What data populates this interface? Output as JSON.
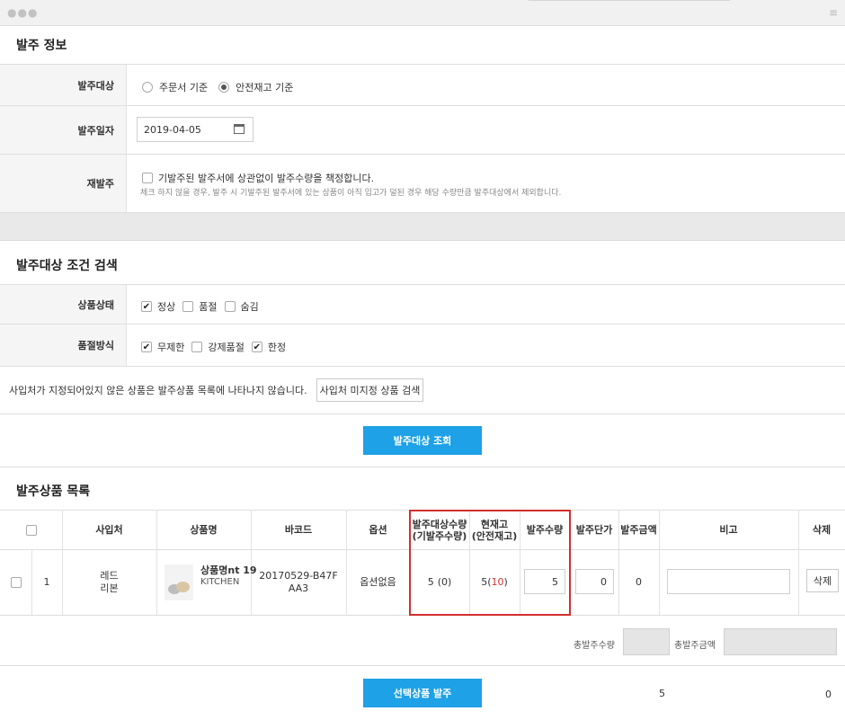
{
  "window": {
    "dots": "●●●",
    "menu_icon": "hamburger-icon"
  },
  "order_info": {
    "title": "발주 정보",
    "target": {
      "label": "발주대상",
      "options": [
        "주문서 기준",
        "안전재고 기준"
      ],
      "selected": "안전재고 기준"
    },
    "date": {
      "label": "발주일자",
      "value": "2019-04-05",
      "icon": "calendar-icon"
    },
    "reorder": {
      "label": "재발주",
      "checkbox_label": "기발주된 발주서에 상관없이 발주수량을 책정합니다.",
      "checked": false,
      "note": "체크 하지 않을 경우, 발주 시 기발주된 발주서에 있는 상품이 아직 입고가 덜된 경우 해당 수량만큼 발주대상에서 제외합니다."
    }
  },
  "search": {
    "title": "발주대상 조건 검색",
    "status": {
      "label": "상품상태",
      "options": [
        {
          "label": "정상",
          "checked": true
        },
        {
          "label": "품절",
          "checked": false
        },
        {
          "label": "숨김",
          "checked": false
        }
      ]
    },
    "soldout_method": {
      "label": "품절방식",
      "options": [
        {
          "label": "무제한",
          "checked": true
        },
        {
          "label": "강제품절",
          "checked": false
        },
        {
          "label": "한정",
          "checked": true
        }
      ]
    },
    "supplier_note": "사입처가 지정되어있지 않은 상품은 발주상품 목록에 나타나지 않습니다.",
    "supplier_button": "사입처 미지정 상품 검색",
    "search_button": "발주대상 조회"
  },
  "product_list": {
    "title": "발주상품 목록",
    "headers": {
      "supplier": "사입처",
      "product_name": "상품명",
      "barcode": "바코드",
      "option": "옵션",
      "order_target_line1": "발주대상수량",
      "order_target_line2": "(기발주수량)",
      "stock_line1": "현재고",
      "stock_line2": "(안전재고)",
      "order_qty": "발주수량",
      "unit_price": "발주단가",
      "amount": "발주금액",
      "memo": "비고",
      "delete": "삭제"
    },
    "rows": [
      {
        "no": "1",
        "supplier_line1": "레드",
        "supplier_line2": "리본",
        "product_name": "상품명nt 19",
        "product_sub": "KITCHEN",
        "barcode_line1": "20170529-B47F",
        "barcode_line2": "AA3",
        "option": "옵션없음",
        "target_qty": "5",
        "target_prev": "(0)",
        "stock": "5",
        "stock_safety": "10",
        "order_qty": "5",
        "unit_price": "0",
        "amount": "0",
        "memo": "",
        "delete_label": "삭제"
      }
    ],
    "summary": {
      "total_qty_label": "총발주수량",
      "total_amount_label": "총발주금액"
    },
    "order_button": "선택상품 발주",
    "footer_qty": "5",
    "footer_amount": "0"
  },
  "colors": {
    "accent": "#1ea1e6",
    "highlight_border": "#d32f2f",
    "label_bg": "#f5f5f5"
  }
}
